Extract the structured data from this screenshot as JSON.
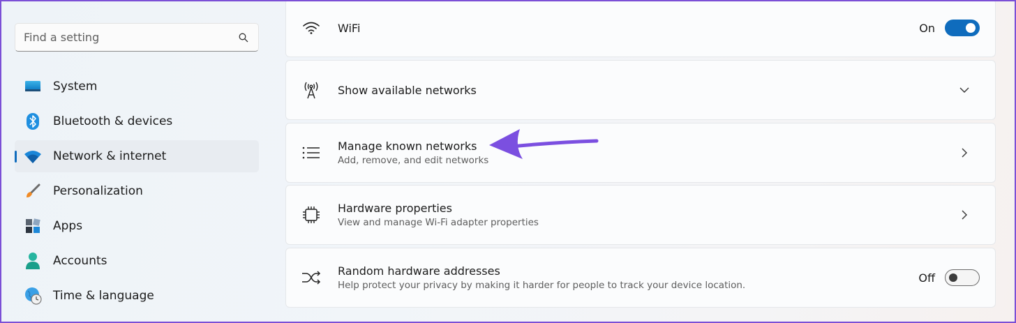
{
  "search": {
    "placeholder": "Find a setting"
  },
  "sidebar": {
    "items": [
      {
        "label": "System",
        "icon": "system-icon"
      },
      {
        "label": "Bluetooth & devices",
        "icon": "bluetooth-icon"
      },
      {
        "label": "Network & internet",
        "icon": "wifi-icon",
        "active": true
      },
      {
        "label": "Personalization",
        "icon": "brush-icon"
      },
      {
        "label": "Apps",
        "icon": "apps-icon"
      },
      {
        "label": "Accounts",
        "icon": "account-icon"
      },
      {
        "label": "Time & language",
        "icon": "globe-clock-icon"
      }
    ]
  },
  "settings": {
    "wifi": {
      "title": "WiFi",
      "state": "On"
    },
    "available": {
      "title": "Show available networks"
    },
    "known": {
      "title": "Manage known networks",
      "desc": "Add, remove, and edit networks"
    },
    "hardware": {
      "title": "Hardware properties",
      "desc": "View and manage Wi-Fi adapter properties"
    },
    "random": {
      "title": "Random hardware addresses",
      "desc": "Help protect your privacy by making it harder for people to track your device location.",
      "state": "Off"
    }
  },
  "colors": {
    "accent": "#0f6cbd",
    "annotation_arrow": "#7b4fe0",
    "frame": "#7b4fd6"
  }
}
